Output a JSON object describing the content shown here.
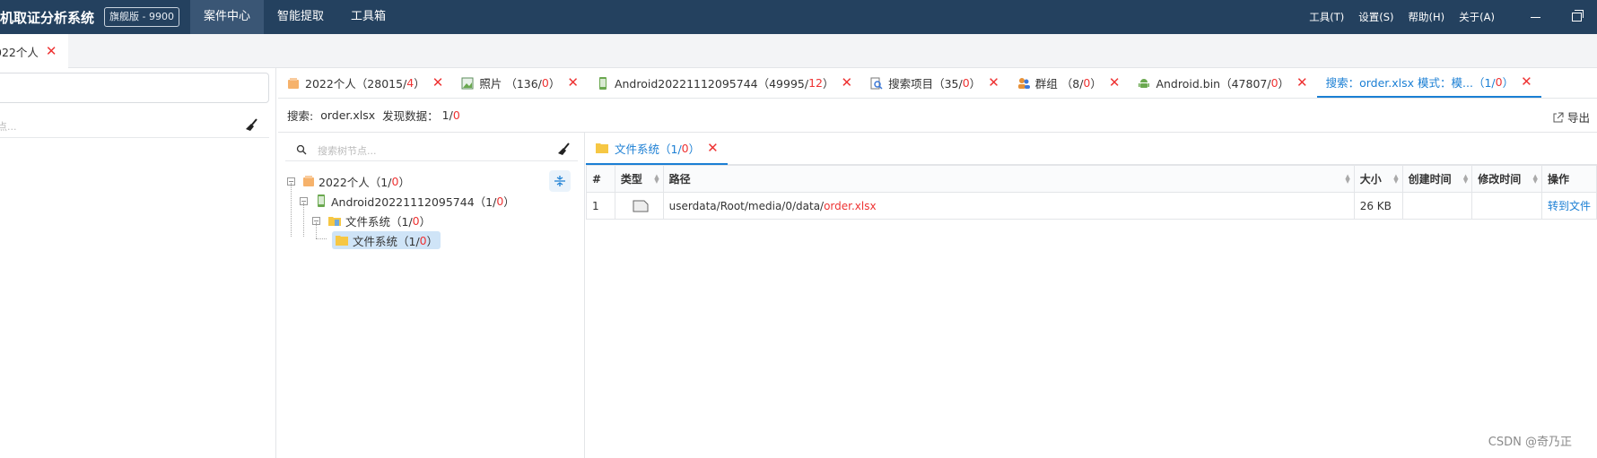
{
  "titlebar": {
    "app_title": "机取证分析系统",
    "edition": "旗舰版 - 9900",
    "menu": [
      "案件中心",
      "智能提取",
      "工具箱"
    ],
    "right_menu": [
      "工具(T)",
      "设置(S)",
      "帮助(H)",
      "关于(A)"
    ]
  },
  "case_tab": {
    "label": "022个人"
  },
  "left": {
    "filter_placeholder": "点..."
  },
  "tabs": [
    {
      "label": "2022个人（28015/",
      "count": "4",
      "end": "）",
      "icon": "case-icon"
    },
    {
      "label": "照片 （136/",
      "count": "0",
      "end": "）",
      "icon": "photo-icon"
    },
    {
      "label": "Android20221112095744（49995/",
      "count": "12",
      "end": "）",
      "icon": "phone-icon"
    },
    {
      "label": "搜索项目（35/",
      "count": "0",
      "end": "）",
      "icon": "search-doc-icon"
    },
    {
      "label": "群组 （8/",
      "count": "0",
      "end": "）",
      "icon": "group-icon"
    },
    {
      "label": "Android.bin（47807/",
      "count": "0",
      "end": "）",
      "icon": "android-icon"
    },
    {
      "label": "搜索：order.xlsx  模式：模...（1/",
      "count": "0",
      "end": "）",
      "icon": ""
    }
  ],
  "search_info": {
    "search_label": "搜索:",
    "search_value": "order.xlsx",
    "found_label": "发现数据：",
    "found_value": "1/",
    "found_red": "0",
    "export_label": "导出"
  },
  "tree": {
    "placeholder": "搜索树节点...",
    "nodes": [
      {
        "label": "2022个人（1/",
        "red": "0",
        "end": "）"
      },
      {
        "label": "Android20221112095744（1/",
        "red": "0",
        "end": "）"
      },
      {
        "label": "文件系统（1/",
        "red": "0",
        "end": "）"
      },
      {
        "label": "文件系统（1/",
        "red": "0",
        "end": "）"
      }
    ]
  },
  "subtab": {
    "label": "文件系统（1/",
    "red": "0",
    "end": "）"
  },
  "grid": {
    "columns": [
      "#",
      "类型",
      "路径",
      "大小",
      "创建时间",
      "修改时间",
      "操作"
    ],
    "rows": [
      {
        "index": "1",
        "path_prefix": "userdata/Root/media/0/data/",
        "path_hit": "order.xlsx",
        "size": "26 KB",
        "created": "",
        "modified": "",
        "action": "转到文件"
      }
    ]
  },
  "watermark": "CSDN @奇乃正"
}
